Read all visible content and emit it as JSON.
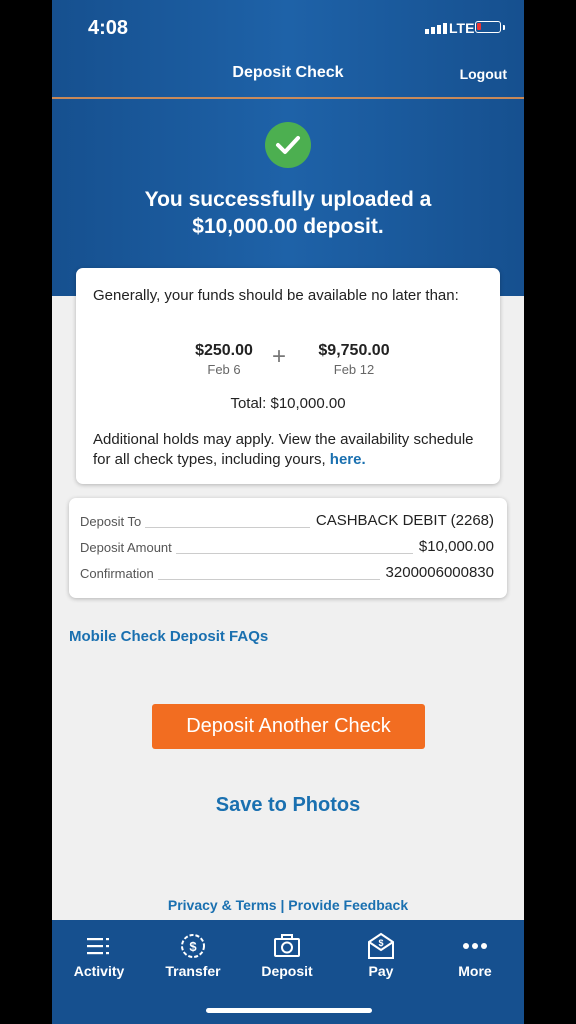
{
  "status": {
    "time": "4:08",
    "network": "LTE"
  },
  "nav": {
    "title": "Deposit Check",
    "logout": "Logout"
  },
  "success": {
    "line1": "You successfully uploaded a",
    "line2": "$10,000.00 deposit."
  },
  "funds": {
    "intro": "Generally, your funds should be available no later than:",
    "amounts": [
      {
        "value": "$250.00",
        "date": "Feb 6"
      },
      {
        "value": "$9,750.00",
        "date": "Feb 12"
      }
    ],
    "plus": "+",
    "total": "Total: $10,000.00",
    "holds_text": "Additional holds may apply. View the availability schedule for all check types, including yours,",
    "holds_link": "here."
  },
  "details": [
    {
      "label": "Deposit To",
      "value": "CASHBACK DEBIT (2268)"
    },
    {
      "label": "Deposit Amount",
      "value": "$10,000.00"
    },
    {
      "label": "Confirmation",
      "value": "3200006000830"
    }
  ],
  "faq_link": "Mobile Check Deposit FAQs",
  "deposit_another": "Deposit Another Check",
  "save_photos": "Save to Photos",
  "footer": {
    "privacy": "Privacy & Terms",
    "separator": "|",
    "feedback": "Provide Feedback"
  },
  "tabs": [
    {
      "label": "Activity",
      "icon": "list-icon"
    },
    {
      "label": "Transfer",
      "icon": "dollar-transfer-icon"
    },
    {
      "label": "Deposit",
      "icon": "camera-icon"
    },
    {
      "label": "Pay",
      "icon": "envelope-dollar-icon"
    },
    {
      "label": "More",
      "icon": "more-dots-icon"
    }
  ],
  "colors": {
    "primary": "#16508f",
    "accent": "#f26d21",
    "link": "#1a70b0",
    "success": "#4caf50"
  }
}
